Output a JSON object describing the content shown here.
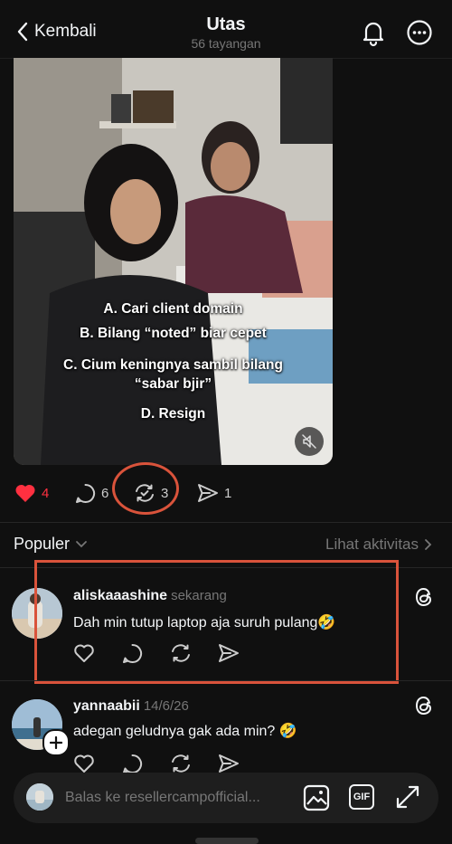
{
  "header": {
    "back_label": "Kembali",
    "title": "Utas",
    "views": "56 tayangan"
  },
  "media": {
    "overlay_lines": [
      "A. Cari client domain",
      "B. Bilang “noted” biar cepet",
      "C. Cium keningnya sambil bilang",
      "“sabar bjir”",
      "D. Resign"
    ]
  },
  "actions": {
    "likes": "4",
    "comments": "6",
    "reposts": "3",
    "shares": "1",
    "like_color": "#ff3040"
  },
  "sort": {
    "label": "Populer",
    "activity_link": "Lihat aktivitas"
  },
  "comments": [
    {
      "username": "aliskaaashine",
      "time": "sekarang",
      "text": "Dah min tutup laptop aja suruh pulang🤣"
    },
    {
      "username": "yannaabii",
      "time": "14/6/26",
      "text": "adegan geludnya gak ada min? 🤣"
    }
  ],
  "reply": {
    "placeholder": "Balas ke resellercampofficial...",
    "gif_label": "GIF"
  },
  "accent_color": "#d9533b"
}
